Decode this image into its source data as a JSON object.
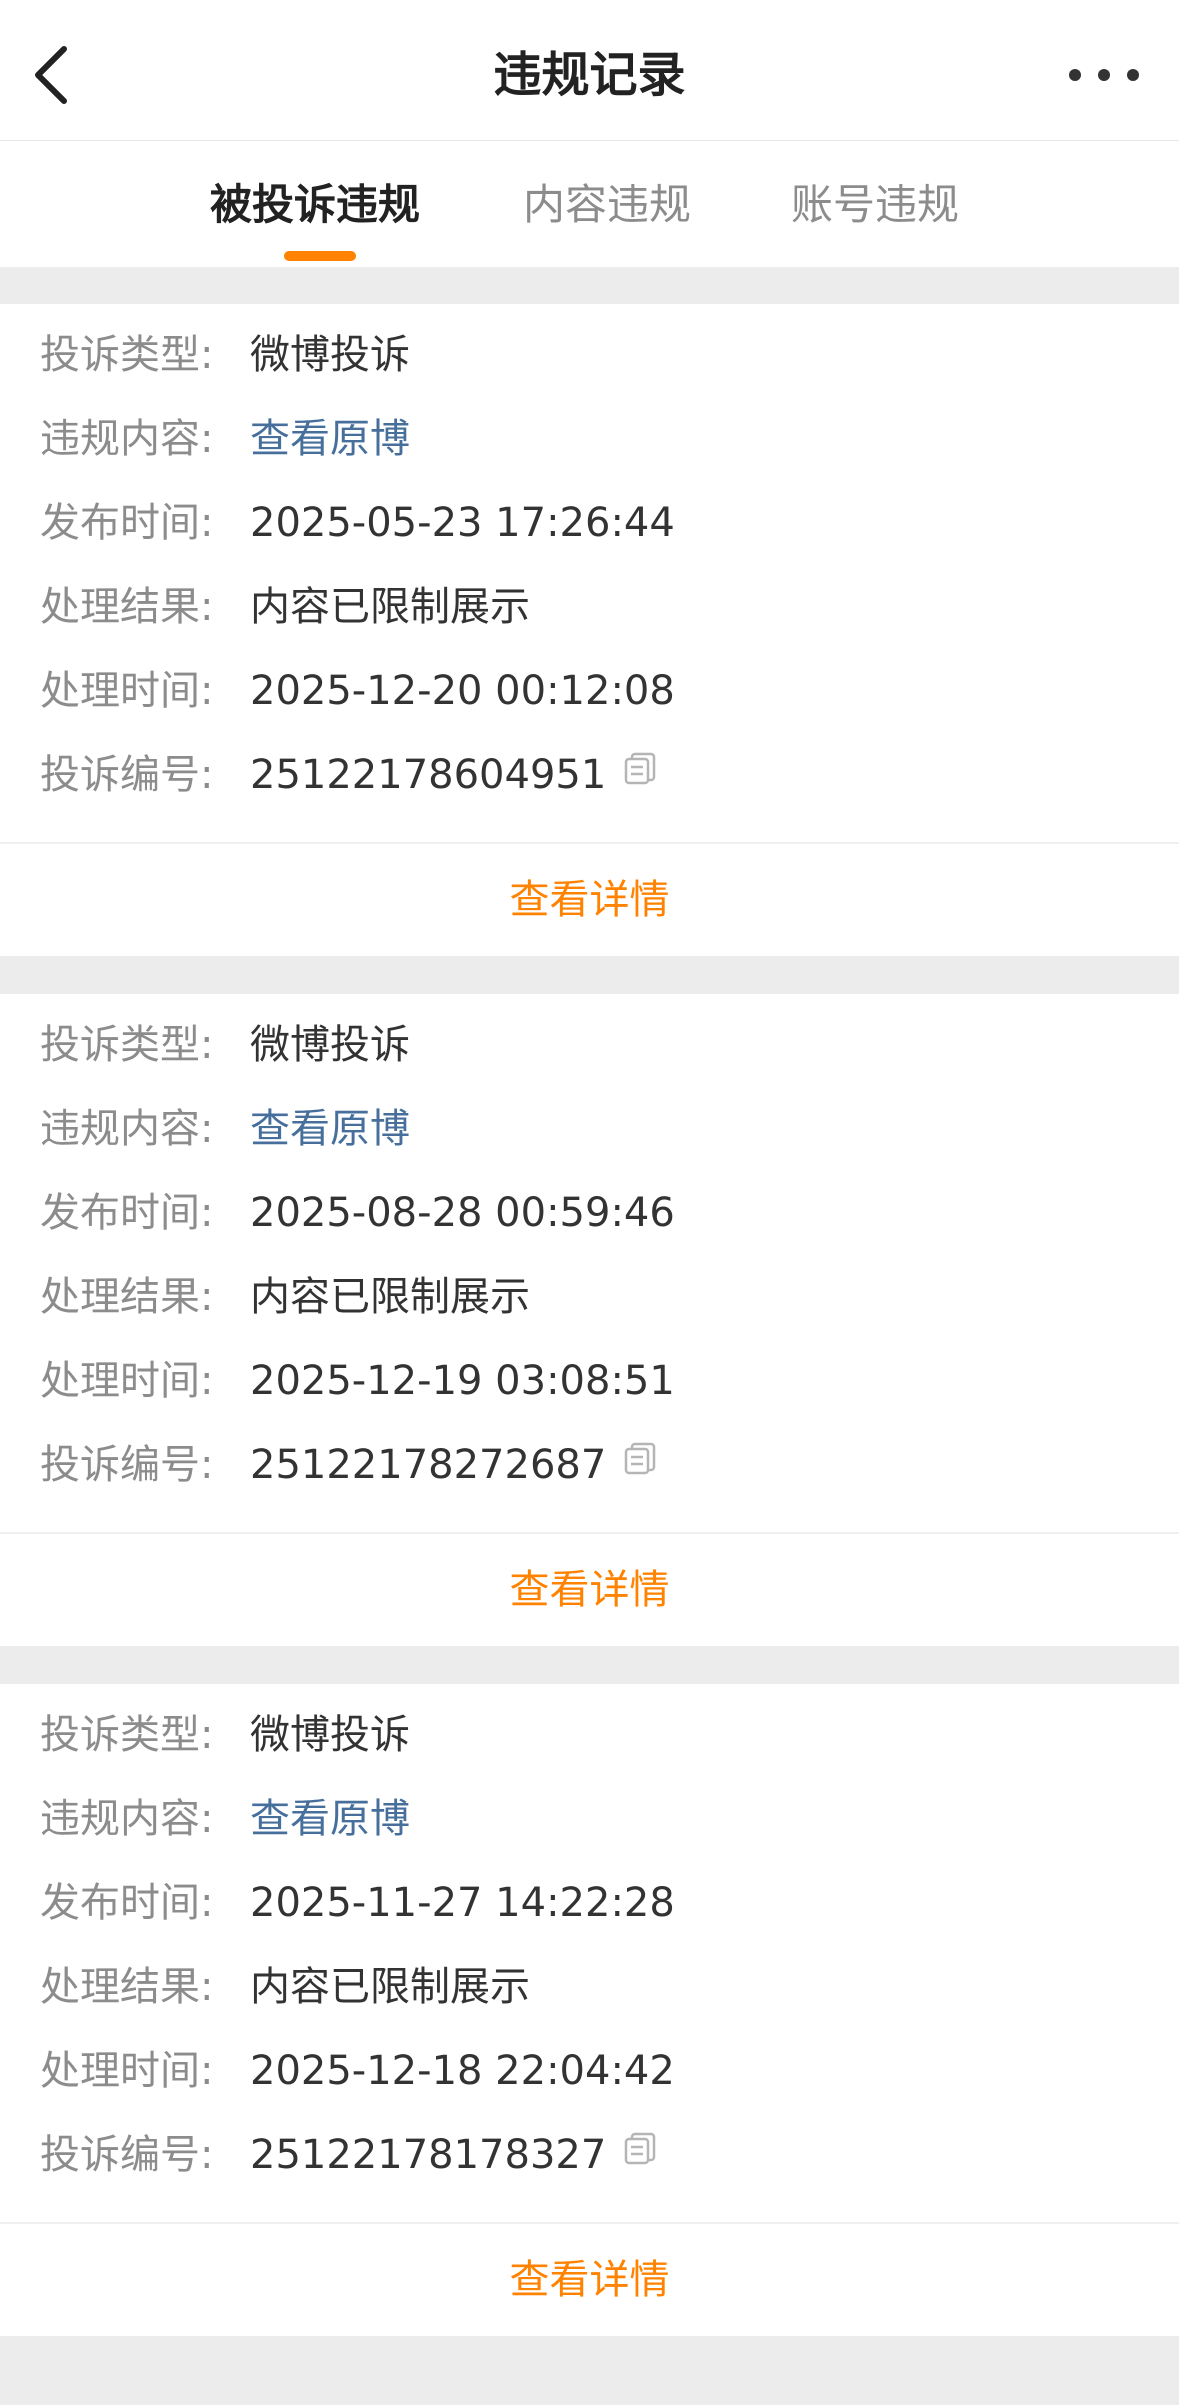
{
  "header": {
    "title": "违规记录"
  },
  "tabs": [
    {
      "label": "被投诉违规",
      "active": true
    },
    {
      "label": "内容违规",
      "active": false
    },
    {
      "label": "账号违规",
      "active": false
    }
  ],
  "labels": {
    "type": "投诉类型:",
    "content": "违规内容:",
    "publish_time": "发布时间:",
    "result": "处理结果:",
    "handle_time": "处理时间:",
    "complaint_no": "投诉编号:"
  },
  "records": [
    {
      "type": "微博投诉",
      "content_link": "查看原博",
      "publish_time": "2025-05-23 17:26:44",
      "result": "内容已限制展示",
      "handle_time": "2025-12-20 00:12:08",
      "complaint_no": "25122178604951",
      "detail_label": "查看详情"
    },
    {
      "type": "微博投诉",
      "content_link": "查看原博",
      "publish_time": "2025-08-28 00:59:46",
      "result": "内容已限制展示",
      "handle_time": "2025-12-19 03:08:51",
      "complaint_no": "25122178272687",
      "detail_label": "查看详情"
    },
    {
      "type": "微博投诉",
      "content_link": "查看原博",
      "publish_time": "2025-11-27 14:22:28",
      "result": "内容已限制展示",
      "handle_time": "2025-12-18 22:04:42",
      "complaint_no": "25122178178327",
      "detail_label": "查看详情"
    }
  ],
  "colors": {
    "accent": "#ff8200",
    "link": "#476f9c",
    "label": "#8c8c8c"
  }
}
